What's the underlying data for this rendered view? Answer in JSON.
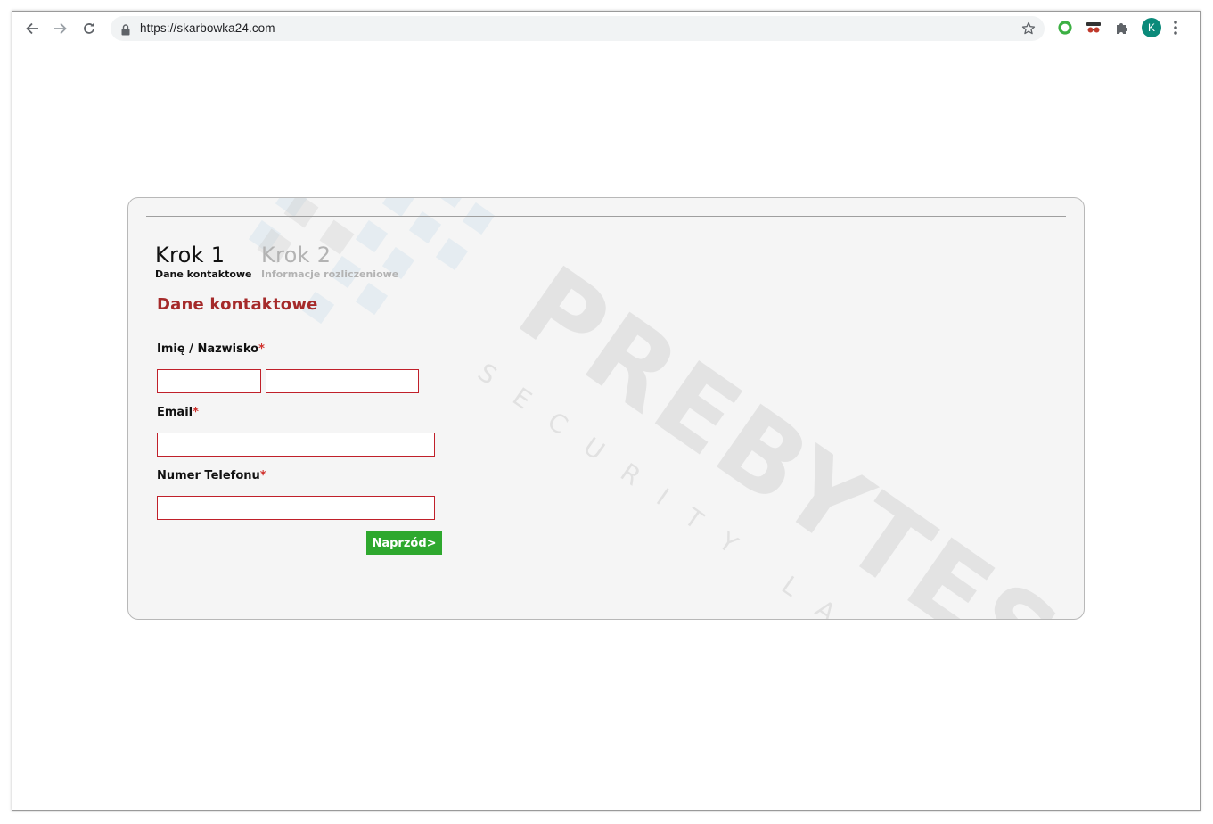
{
  "browser": {
    "url": "https://skarbowka24.com",
    "profile_initial": "K",
    "icons": [
      "back-icon",
      "forward-icon",
      "reload-icon",
      "lock-icon",
      "star-icon",
      "green-ring-extension-icon",
      "incognito-extension-icon",
      "puzzle-extension-icon",
      "kebab-menu-icon"
    ]
  },
  "steps": [
    {
      "title": "Krok 1",
      "subtitle": "Dane kontaktowe",
      "state": "active"
    },
    {
      "title": "Krok 2",
      "subtitle": "Informacje rozliczeniowe",
      "state": "inactive"
    }
  ],
  "form": {
    "section_title": "Dane kontaktowe",
    "required_marker": "*",
    "fields": {
      "name": {
        "label": "Imię / Nazwisko",
        "first_value": "",
        "last_value": ""
      },
      "email": {
        "label": "Email",
        "value": ""
      },
      "phone": {
        "label": "Numer Telefonu",
        "value": ""
      }
    },
    "next_button": "Naprzód>"
  },
  "watermark": {
    "brand": "PREBYTES",
    "tagline": "SECURITY LAYER"
  },
  "colors": {
    "section_title": "#a52a2a",
    "input_border": "#c0202a",
    "required": "#d0312d",
    "button": "#2ea82e",
    "panel_bg": "#f5f5f5",
    "avatar": "#0b8a7a"
  }
}
